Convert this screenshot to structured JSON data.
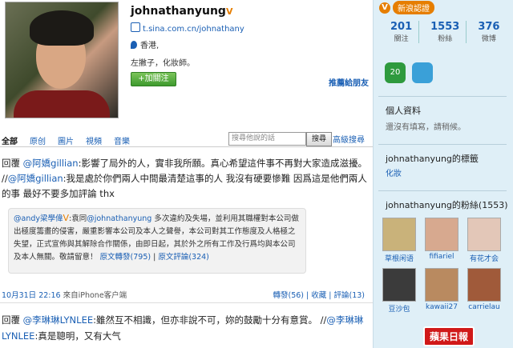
{
  "profile": {
    "username": "johnathanyung",
    "verified_mark": "V",
    "url": "t.sina.com.cn/johnathany",
    "location": "香港,",
    "bio": "左撇子，化妝師。",
    "follow_label": "+加關注",
    "recommend_label": "推薦給朋友"
  },
  "tabs": [
    "全部",
    "原创",
    "圖片",
    "視頻",
    "音樂"
  ],
  "search": {
    "placeholder": "搜尋他說的話",
    "button": "搜尋",
    "advanced": "高級搜尋"
  },
  "post1": {
    "prefix": "回覆 ",
    "at1": "@阿嬌gillian",
    "text1": ":影響了局外的人，實非我所願。真心希望這件事不再對大家造成滋擾。",
    "sep": " //",
    "at2": "@阿嬌gillian",
    "text2": ":我是處於你們兩人中間最清楚這事的人 我沒有硬要慘難 因爲這是他們兩人的事 最好不要多加評論 thx"
  },
  "quote": {
    "at": "@andy梁學偉",
    "vmark": "V",
    "text_a": ":袁同",
    "at2": "@johnathanyung",
    "text_b": " 多次違約及失場，並利用其職權對本公司做出極度籌畫的侵害，嚴重影響本公司及本人之聲譽，本公司對其工作態度及人格極之失望，正式宣佈與其解除合作關係，由即日起，其於外之所有工作及行爲均與本公司及本人無關。敬請留意！",
    "repost": "原文轉發(795)",
    "comment": "原文評論(324)"
  },
  "meta": {
    "date": "10月31日 22:16",
    "source": "來自iPhone客户端",
    "actions": "轉發(56) | 收藏 | 評論(13)"
  },
  "post2": {
    "prefix": "回覆 ",
    "at1": "@李琳琳LYNLEE",
    "text1": ":雖然互不相識，但亦非說不可，妳的鼓勵十分有意賞。 //",
    "at2": "@李琳琳LYNLEE",
    "text2": ":真是聰明，又有大气"
  },
  "sidebar": {
    "badge_icon": "V",
    "badge_label": "新浪認證",
    "stats": [
      {
        "n": "201",
        "l": "關注"
      },
      {
        "n": "1553",
        "l": "粉絲"
      },
      {
        "n": "376",
        "l": "微博"
      }
    ],
    "icon1_label": "20",
    "profile_head": "個人資料",
    "profile_sub": "還沒有填寫，請稍候。",
    "tags_head": "johnathanyung的標籤",
    "tag": "化妝",
    "fans_head": "johnathanyung的粉絲(1553)",
    "fans": [
      {
        "name": "草根闲语",
        "color": "#c9b27a"
      },
      {
        "name": "fifiariel",
        "color": "#d7a98f"
      },
      {
        "name": "有花才会",
        "color": "#e3c7b8"
      },
      {
        "name": "豆沙包",
        "color": "#3b3b3b"
      },
      {
        "name": "kawaii27",
        "color": "#b98a60"
      },
      {
        "name": "carrielau",
        "color": "#a05a3a"
      }
    ]
  },
  "watermark": "蘋果日報"
}
